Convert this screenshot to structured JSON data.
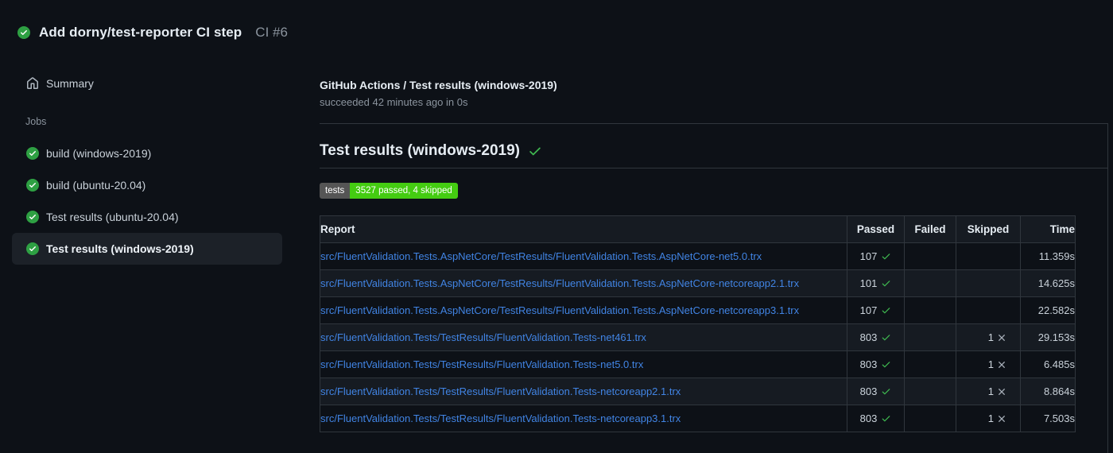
{
  "page": {
    "run_title": "Add dorny/test-reporter CI step",
    "run_number": "CI #6",
    "run_status": "success"
  },
  "sidebar": {
    "summary_label": "Summary",
    "jobs_label": "Jobs",
    "jobs": [
      {
        "label": "build (windows-2019)",
        "status": "success",
        "selected": false
      },
      {
        "label": "build (ubuntu-20.04)",
        "status": "success",
        "selected": false
      },
      {
        "label": "Test results (ubuntu-20.04)",
        "status": "success",
        "selected": false
      },
      {
        "label": "Test results (windows-2019)",
        "status": "success",
        "selected": true
      }
    ]
  },
  "main": {
    "check_title": "GitHub Actions / Test results (windows-2019)",
    "check_subtitle": "succeeded 42 minutes ago in 0s",
    "section_heading": "Test results (windows-2019)",
    "section_status": "success",
    "badge": {
      "label": "tests",
      "value": "3527 passed, 4 skipped",
      "label_bg": "#555555",
      "value_bg": "#44cc11"
    },
    "table": {
      "columns": [
        "Report",
        "Passed",
        "Failed",
        "Skipped",
        "Time"
      ],
      "rows": [
        {
          "report": "src/FluentValidation.Tests.AspNetCore/TestResults/FluentValidation.Tests.AspNetCore-net5.0.trx",
          "passed": "107",
          "failed": "",
          "skipped": "",
          "time": "11.359s"
        },
        {
          "report": "src/FluentValidation.Tests.AspNetCore/TestResults/FluentValidation.Tests.AspNetCore-netcoreapp2.1.trx",
          "passed": "101",
          "failed": "",
          "skipped": "",
          "time": "14.625s"
        },
        {
          "report": "src/FluentValidation.Tests.AspNetCore/TestResults/FluentValidation.Tests.AspNetCore-netcoreapp3.1.trx",
          "passed": "107",
          "failed": "",
          "skipped": "",
          "time": "22.582s"
        },
        {
          "report": "src/FluentValidation.Tests/TestResults/FluentValidation.Tests-net461.trx",
          "passed": "803",
          "failed": "",
          "skipped": "1",
          "time": "29.153s"
        },
        {
          "report": "src/FluentValidation.Tests/TestResults/FluentValidation.Tests-net5.0.trx",
          "passed": "803",
          "failed": "",
          "skipped": "1",
          "time": "6.485s"
        },
        {
          "report": "src/FluentValidation.Tests/TestResults/FluentValidation.Tests-netcoreapp2.1.trx",
          "passed": "803",
          "failed": "",
          "skipped": "1",
          "time": "8.864s"
        },
        {
          "report": "src/FluentValidation.Tests/TestResults/FluentValidation.Tests-netcoreapp3.1.trx",
          "passed": "803",
          "failed": "",
          "skipped": "1",
          "time": "7.503s"
        }
      ]
    }
  },
  "icons": {
    "success_circle": "check-circle-icon",
    "check": "check-icon",
    "cross": "x-icon",
    "home": "home-icon"
  },
  "colors": {
    "background": "#0d1117",
    "row_alt": "#161b22",
    "border": "#30363d",
    "selected_item_bg": "#1c2128",
    "text_primary": "#e6edf3",
    "text_secondary": "#c9d1d9",
    "text_muted": "#8b949e",
    "link": "#4184e4",
    "success_green": "#2ea043",
    "check_green": "#3fb950",
    "x_gray": "#a8b0ba",
    "badge_label_bg": "#555555",
    "badge_value_bg": "#44cc11"
  }
}
